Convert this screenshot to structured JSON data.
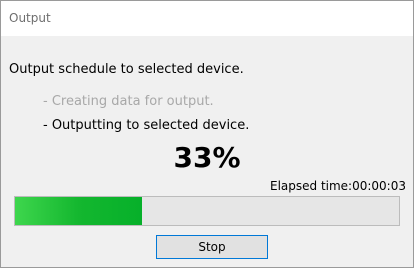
{
  "window": {
    "title": "Output"
  },
  "message": "Output schedule to selected device.",
  "steps": [
    {
      "label": "- Creating data for output.",
      "state": "done"
    },
    {
      "label": "- Outputting to selected device.",
      "state": "active"
    }
  ],
  "progress": {
    "percent_label": "33%",
    "fraction": 0.33,
    "elapsed_label": "Elapsed time:00:00:03",
    "fill_color": "#06b02a"
  },
  "buttons": {
    "stop_label": "Stop"
  }
}
